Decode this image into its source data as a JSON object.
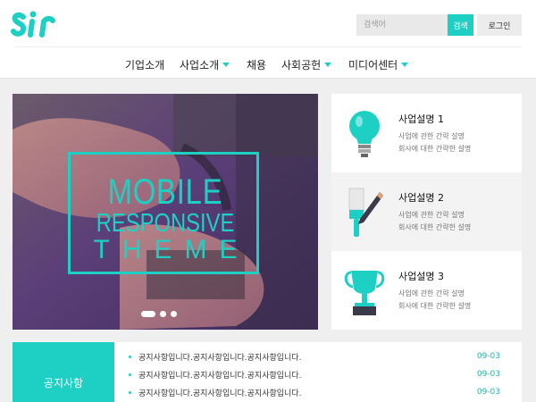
{
  "header": {
    "logo_text": "sir",
    "search": {
      "placeholder": "검색어",
      "button_label": "검색"
    },
    "login_label": "로그인"
  },
  "nav": {
    "items": [
      {
        "label": "기업소개",
        "has_submenu": false
      },
      {
        "label": "사업소개",
        "has_submenu": true
      },
      {
        "label": "채용",
        "has_submenu": false
      },
      {
        "label": "사회공헌",
        "has_submenu": true
      },
      {
        "label": "미디어센터",
        "has_submenu": true
      }
    ]
  },
  "banner": {
    "line1": "MOBILE",
    "line2": "RESPONSIVE",
    "line3": "THEME",
    "slide_count": 3,
    "active_slide": 1
  },
  "services": [
    {
      "title": "사업설명 1",
      "desc1": "사업에 관한 간략 설명",
      "desc2": "회사에 대한 간략한 설명",
      "icon": "lightbulb-icon"
    },
    {
      "title": "사업설명 2",
      "desc1": "사업에 관한 간략 설명",
      "desc2": "회사에 대한 간략한 설명",
      "icon": "paint-brush-icon"
    },
    {
      "title": "사업설명 3",
      "desc1": "사업에 관한 간략 설명",
      "desc2": "회사에 대한 간략한 설명",
      "icon": "trophy-icon"
    }
  ],
  "notice": {
    "title": "공지사항",
    "items": [
      {
        "text": "공지사항입니다.공지사항입니다.공지사항입니다.",
        "date": "09-03"
      },
      {
        "text": "공지사항입니다.공지사항입니다.공지사항입니다.",
        "date": "09-03"
      },
      {
        "text": "공지사항입니다.공지사항입니다.공지사항입니다.",
        "date": "09-03"
      }
    ]
  },
  "colors": {
    "accent": "#1ed0c4",
    "accent_dark": "#1ab6ac",
    "page_bg": "#efefef"
  }
}
